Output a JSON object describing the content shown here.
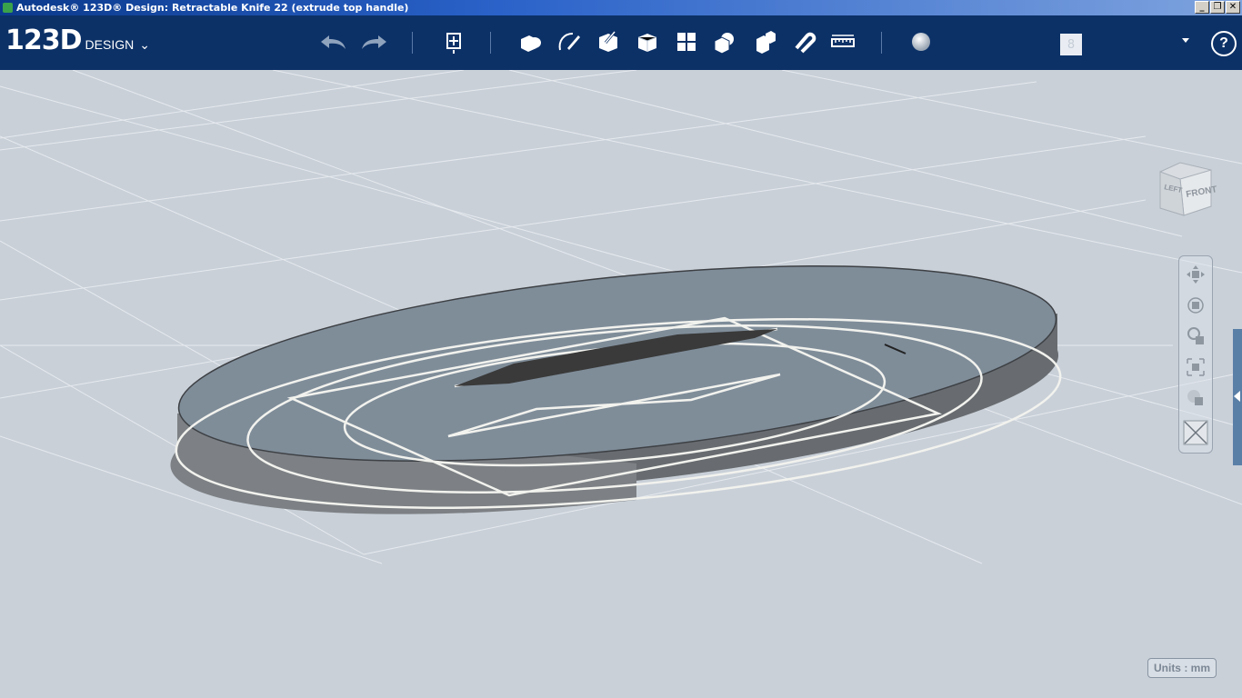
{
  "window": {
    "title": "Autodesk® 123D® Design: Retractable Knife 22 (extrude top handle)",
    "minimize_label": "_",
    "restore_label": "❐",
    "close_label": "✕"
  },
  "toolbar": {
    "logo_main": "123D",
    "logo_sub": "DESIGN",
    "logo_chevron": "⌄",
    "help_label": "?",
    "user_glyph": "8",
    "icons": [
      "undo-icon",
      "redo-icon",
      "transform-icon",
      "primitives-icon",
      "sketch-icon",
      "construct-icon",
      "modify-icon",
      "pattern-icon",
      "grouping-icon",
      "combine-icon",
      "snap-icon",
      "measure-icon",
      "material-icon"
    ]
  },
  "viewcube": {
    "left_label": "LEFT",
    "front_label": "FRONT"
  },
  "navbar": {
    "items": [
      "pan-icon",
      "orbit-icon",
      "zoom-icon",
      "fit-icon",
      "visibility-icon",
      "hide-icon"
    ]
  },
  "status": {
    "units_label": "Units : mm"
  },
  "colors": {
    "toolbar_bg": "#0c3167",
    "viewport_bg": "#c9d0d8",
    "solid_top": "#7a8a98",
    "solid_side": "#6e7378"
  }
}
